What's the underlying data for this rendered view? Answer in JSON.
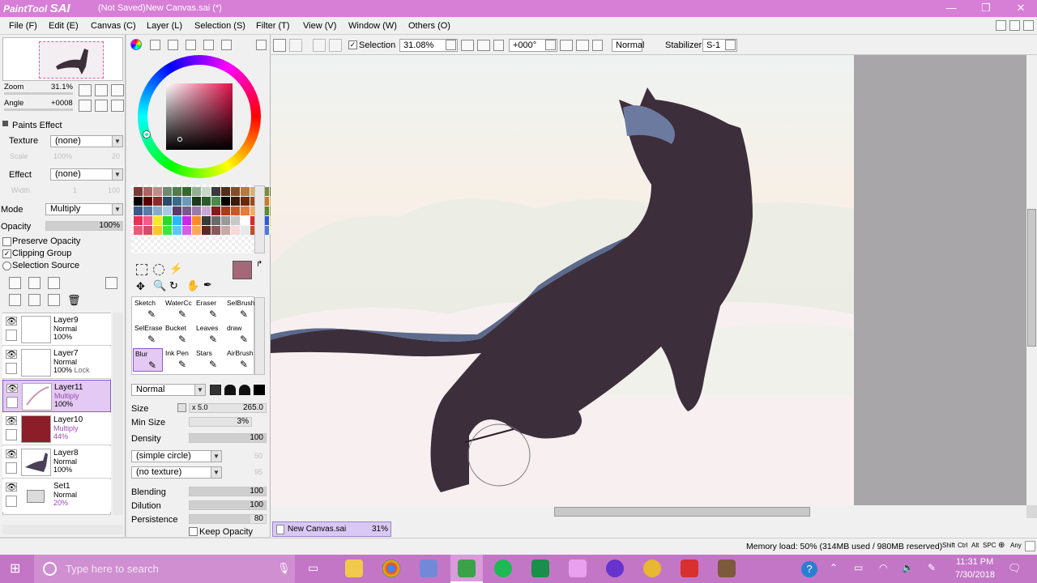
{
  "window": {
    "logo_main": "Paint",
    "logo_tool": "Tool",
    "logo_sai": "SAI",
    "title": "(Not Saved)New Canvas.sai (*)",
    "minimize": "—",
    "maximize": "❐",
    "close": "✕"
  },
  "menu": [
    "File (F)",
    "Edit (E)",
    "Canvas (C)",
    "Layer (L)",
    "Selection (S)",
    "Filter (T)",
    "View (V)",
    "Window (W)",
    "Others (O)"
  ],
  "navigator": {
    "zoom_label": "Zoom",
    "zoom_value": "31.1%",
    "angle_label": "Angle",
    "angle_value": "+0008"
  },
  "paints_effect": {
    "header": "Paints Effect",
    "texture_label": "Texture",
    "texture_value": "(none)",
    "scale_label": "Scale",
    "scale_value": "100%",
    "scale_num": "20",
    "effect_label": "Effect",
    "effect_value": "(none)",
    "width_label": "Width",
    "width_value": "1",
    "width_num": "100"
  },
  "layer_props": {
    "mode_label": "Mode",
    "mode_value": "Multiply",
    "opacity_label": "Opacity",
    "opacity_value": "100%",
    "opacity_fraction": 1.0,
    "preserve_opacity": "Preserve Opacity",
    "clipping_group": "Clipping Group",
    "selection_source": "Selection Source"
  },
  "layers": [
    {
      "name": "Layer9",
      "mode": "Normal",
      "opacity": "100%",
      "extra": "",
      "selected": false
    },
    {
      "name": "Layer7",
      "mode": "Normal",
      "opacity": "100%",
      "extra": "Lock",
      "selected": false
    },
    {
      "name": "Layer11",
      "mode": "Multiply",
      "opacity": "100%",
      "extra": "",
      "selected": true
    },
    {
      "name": "Layer10",
      "mode": "Multiply",
      "opacity": "44%",
      "extra": "",
      "selected": false
    },
    {
      "name": "Layer8",
      "mode": "Normal",
      "opacity": "100%",
      "extra": "",
      "selected": false
    },
    {
      "name": "Set1",
      "mode": "Normal",
      "opacity": "20%",
      "extra": "",
      "selected": false
    }
  ],
  "brushes": [
    [
      "Sketch",
      "WaterCc",
      "Eraser",
      "SelBrush"
    ],
    [
      "SelErase",
      "Bucket",
      "Leaves",
      "draw"
    ],
    [
      "Blur",
      "Ink Pen",
      "Stars",
      "AirBrush"
    ]
  ],
  "brush_settings": {
    "blend_mode": "Normal",
    "size_label": "Size",
    "size_mult": "x 5.0",
    "size_value": "265.0",
    "minsize_label": "Min Size",
    "minsize_value": "3%",
    "density_label": "Density",
    "density_value": "100",
    "shape_value": "(simple circle)",
    "shape_num": "50",
    "texture_value": "(no texture)",
    "texture_num": "95",
    "blending_label": "Blending",
    "blending_value": "100",
    "dilution_label": "Dilution",
    "dilution_value": "100",
    "persistence_label": "Persistence",
    "persistence_value": "80",
    "keep_opacity": "Keep Opacity"
  },
  "toolbar": {
    "selection_label": "Selection",
    "zoom_value": "31.08%",
    "angle_value": "+000°",
    "blend_value": "Normal",
    "stabilizer_label": "Stabilizer",
    "stabilizer_value": "S-1"
  },
  "tab": {
    "name": "New Canvas.sai",
    "zoom": "31%"
  },
  "status": {
    "memory": "Memory load: 50% (314MB used / 980MB reserved)",
    "keys": [
      "Shift",
      "Ctrl",
      "Alt",
      "SPC",
      "Any"
    ]
  },
  "taskbar": {
    "search_placeholder": "Type here to search",
    "time": "11:31 PM",
    "date": "7/30/2018"
  },
  "colors": {
    "accent": "#d77ed6",
    "taskbar": "#c376c6",
    "current_color": "#a5687a",
    "selected_layer": "#e3c9f3",
    "cat_body": "#3d2e3b",
    "cat_highlight": "#5c6a8c"
  }
}
